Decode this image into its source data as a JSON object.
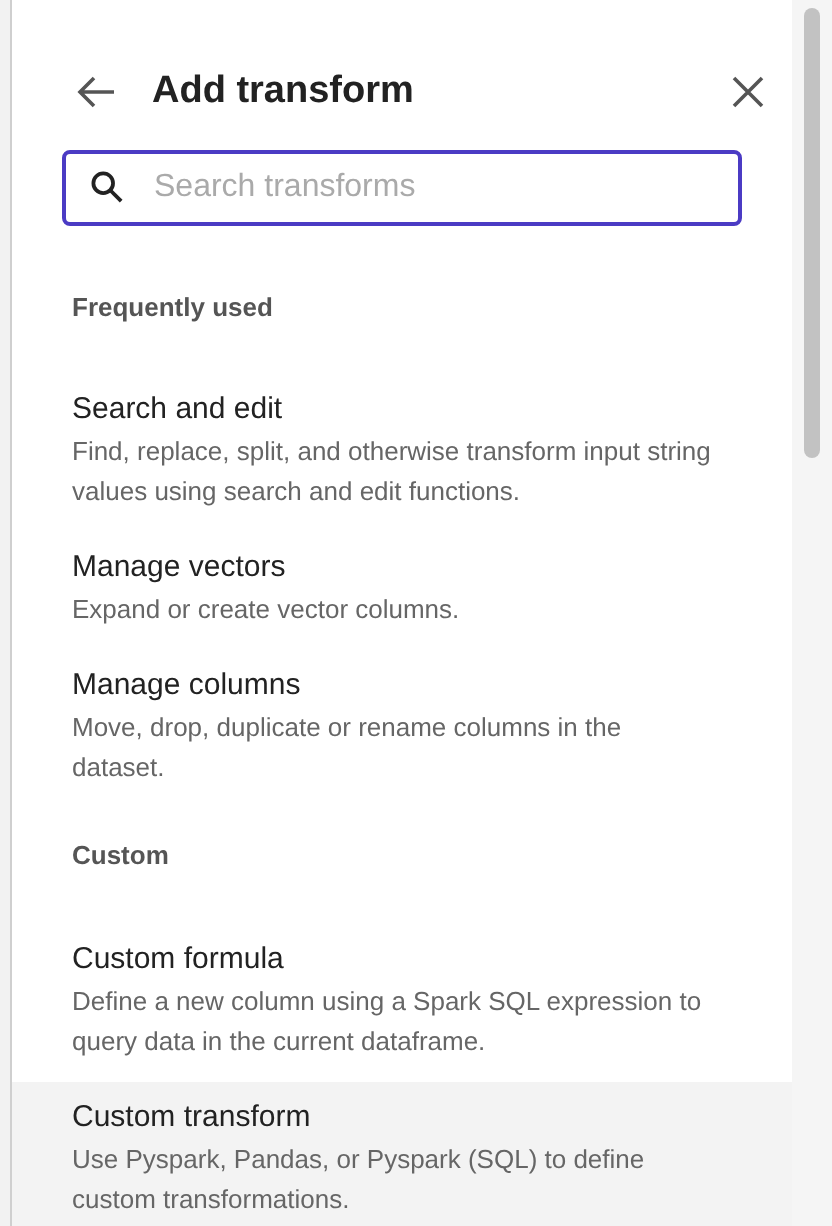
{
  "header": {
    "title": "Add transform"
  },
  "search": {
    "placeholder": "Search transforms"
  },
  "sections": [
    {
      "title": "Frequently used",
      "items": [
        {
          "name": "Search and edit",
          "description": "Find, replace, split, and otherwise transform input string values using search and edit functions.",
          "hovered": false
        },
        {
          "name": "Manage vectors",
          "description": "Expand or create vector columns.",
          "hovered": false
        },
        {
          "name": "Manage columns",
          "description": "Move, drop, duplicate or rename columns in the dataset.",
          "hovered": false
        }
      ]
    },
    {
      "title": "Custom",
      "items": [
        {
          "name": "Custom formula",
          "description": "Define a new column using a Spark SQL expression to query data in the current dataframe.",
          "hovered": false
        },
        {
          "name": "Custom transform",
          "description": "Use Pyspark, Pandas, or Pyspark (SQL) to define custom transformations.",
          "hovered": true
        }
      ]
    }
  ]
}
